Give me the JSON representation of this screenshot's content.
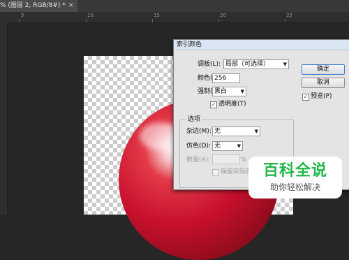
{
  "document_tab": {
    "title": "% (图层 2, RGB/8#) *",
    "close": "×"
  },
  "ruler": {
    "labels": [
      "5",
      "10",
      "15",
      "20",
      "25"
    ]
  },
  "dialog": {
    "title": "索引颜色",
    "palette_label": "调板(L):",
    "palette_value": "局部（可选择）",
    "colors_label": "颜色(C):",
    "colors_value": "256",
    "forced_label": "强制(F):",
    "forced_value": "黑白",
    "transparency_label": "透明度(T)",
    "transparency_checked": true,
    "options_group": "选项",
    "matte_label": "杂边(M):",
    "matte_value": "无",
    "dither_label": "仿色(D):",
    "dither_value": "无",
    "amount_label": "数量(A):",
    "amount_unit": "%",
    "preserve_label": "保留实际颜",
    "ok_button": "确定",
    "cancel_button": "取消",
    "preview_label": "预览(P)",
    "preview_checked": true
  },
  "watermark": {
    "title": "百科全说",
    "subtitle": "助你轻松解决"
  }
}
